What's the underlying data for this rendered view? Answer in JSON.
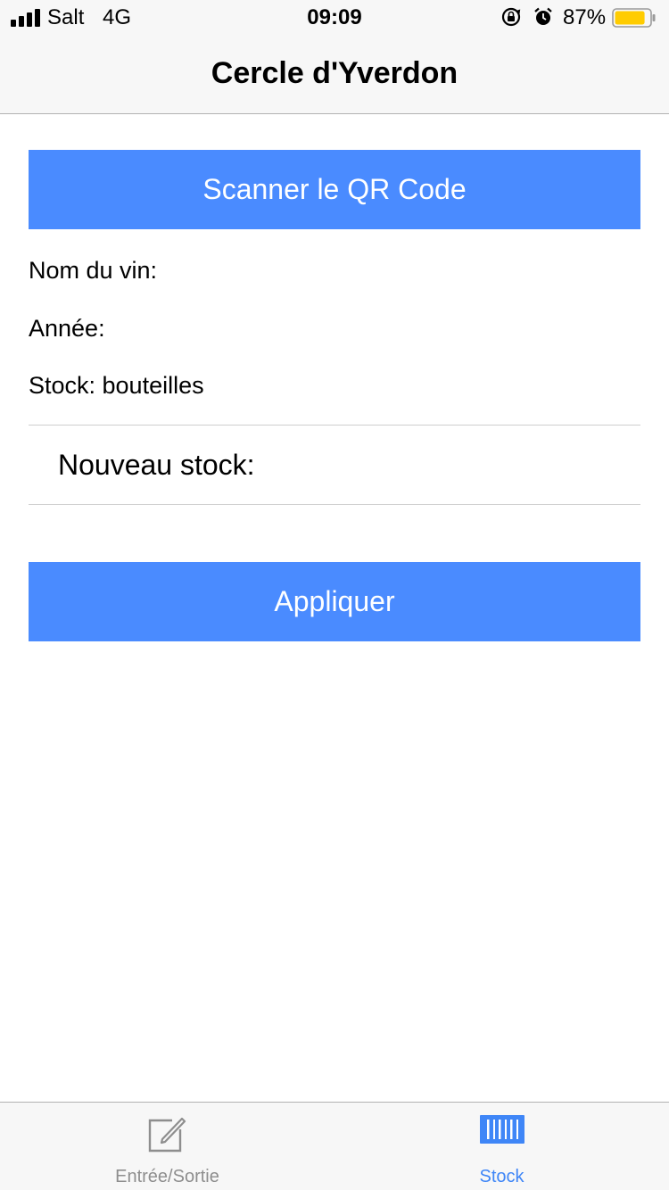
{
  "status_bar": {
    "carrier": "Salt",
    "network": "4G",
    "time": "09:09",
    "battery_percent": "87%",
    "battery_level": 0.87,
    "battery_color": "#ffcc00",
    "icons": [
      "signal-icon",
      "orientation-lock-icon",
      "alarm-icon",
      "battery-icon"
    ]
  },
  "nav": {
    "title": "Cercle d'Yverdon"
  },
  "main": {
    "scan_button_label": "Scanner le QR Code",
    "wine_name_label": "Nom du vin:",
    "year_label": "Année:",
    "stock_label": "Stock: bouteilles",
    "new_stock_label": "Nouveau stock:",
    "new_stock_value": "",
    "apply_button_label": "Appliquer",
    "button_color": "#4a8bff"
  },
  "tab_bar": {
    "tabs": [
      {
        "label": "Entrée/Sortie",
        "icon": "edit-icon",
        "selected": false
      },
      {
        "label": "Stock",
        "icon": "barcode-icon",
        "selected": true
      }
    ],
    "active_color": "#3f86f7",
    "inactive_color": "#8e8e8e"
  }
}
